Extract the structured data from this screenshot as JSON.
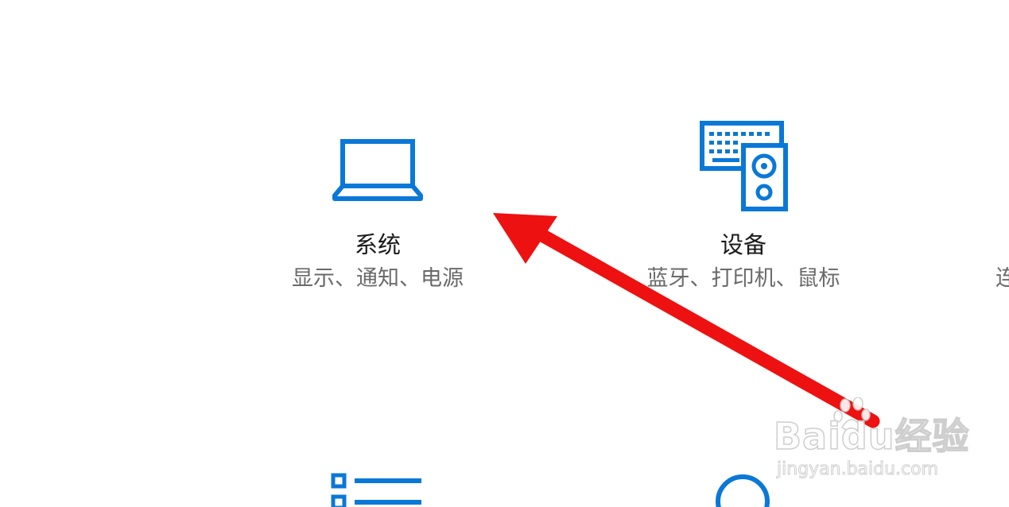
{
  "tiles": {
    "system": {
      "title": "系统",
      "description": "显示、通知、电源",
      "icon": "laptop-icon"
    },
    "devices": {
      "title": "设备",
      "description": "蓝牙、打印机、鼠标",
      "icon": "keyboard-speaker-icon"
    },
    "partial_right": {
      "description": "连"
    },
    "bottom_left": {
      "icon": "apps-list-icon"
    },
    "bottom_right": {
      "icon": "account-icon"
    }
  },
  "annotation": {
    "type": "arrow",
    "color": "#ee1111",
    "points_to": "system"
  },
  "watermark": {
    "logo_text": "Baidu经验",
    "url_text": "jingyan.baidu.com"
  },
  "colors": {
    "accent": "#0a78d7",
    "title": "#1a1a1a",
    "description": "#6a6a6a",
    "background": "#ffffff"
  }
}
